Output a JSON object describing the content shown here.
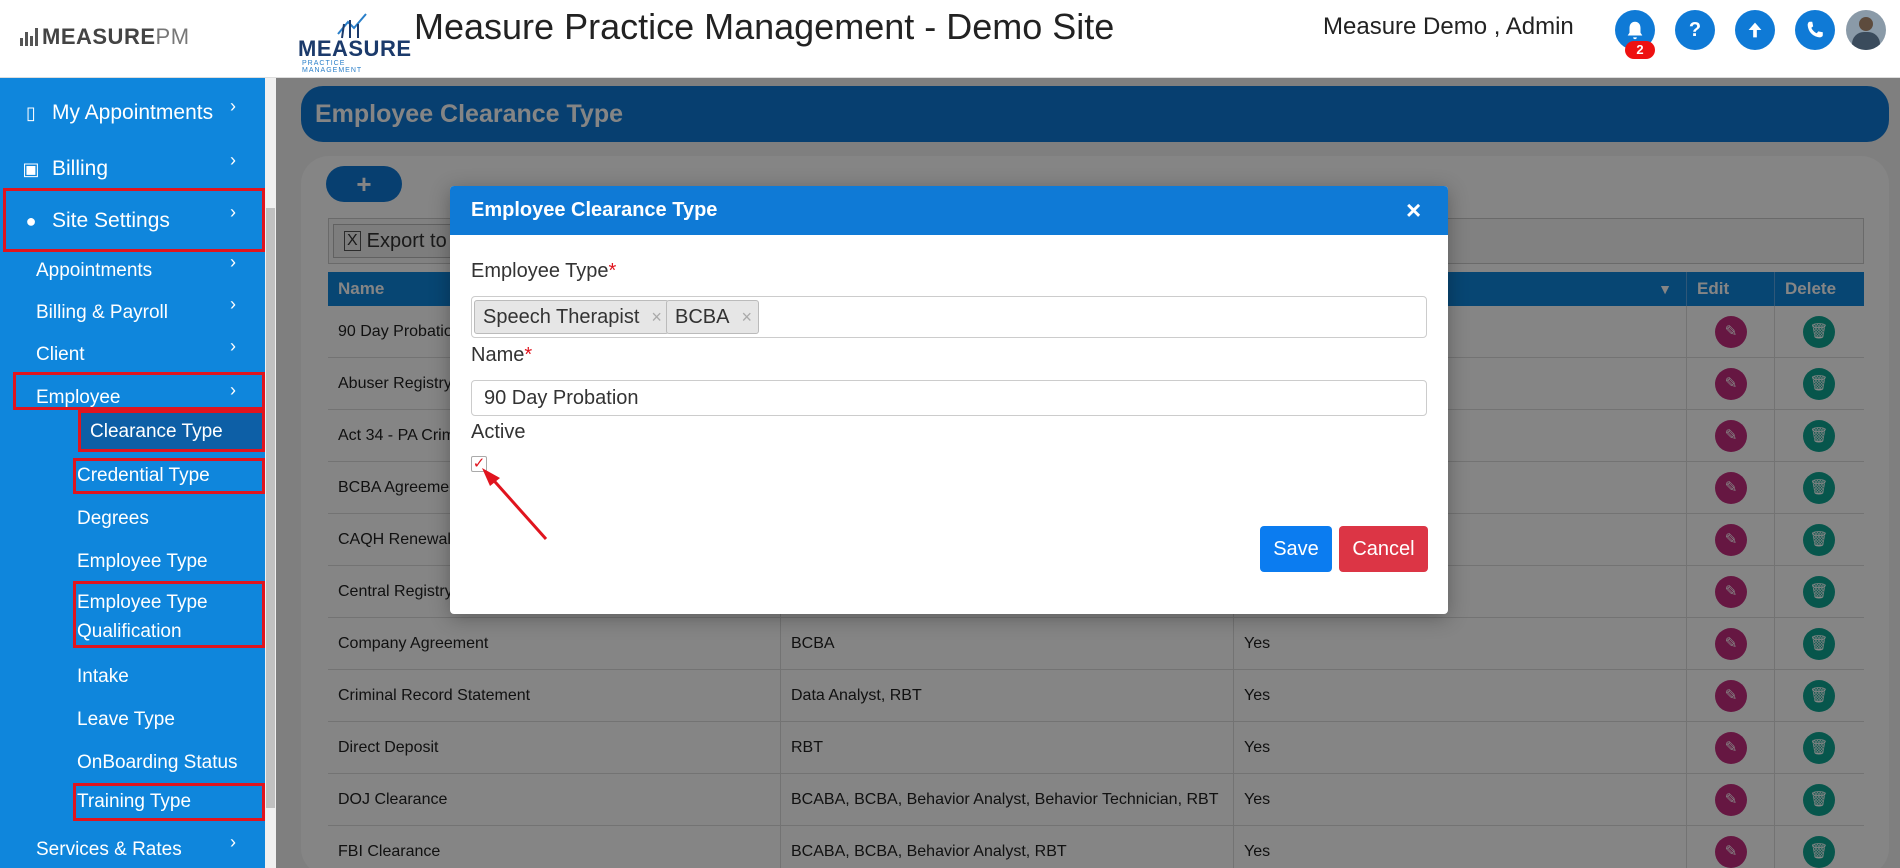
{
  "header": {
    "brand": "MEASURE",
    "brand_suffix": "PM",
    "logo_word": "MEASURE",
    "logo_subtitle": "PRACTICE MANAGEMENT",
    "title": "Measure Practice Management - Demo Site",
    "user": "Measure Demo , Admin",
    "notification_count": "2",
    "icons": [
      "bell-icon",
      "help-icon",
      "upload-icon",
      "phone-icon"
    ]
  },
  "sidebar": {
    "items": [
      {
        "label": "My Appointments",
        "icon": "building-icon"
      },
      {
        "label": "Billing",
        "icon": "money-icon"
      },
      {
        "label": "Site Settings",
        "icon": "user-icon"
      }
    ],
    "site_settings_children": [
      {
        "label": "Appointments"
      },
      {
        "label": "Billing & Payroll"
      },
      {
        "label": "Client"
      },
      {
        "label": "Employee"
      }
    ],
    "employee_children": [
      {
        "label": "Clearance Type"
      },
      {
        "label": "Credential Type"
      },
      {
        "label": "Degrees"
      },
      {
        "label": "Employee Type"
      },
      {
        "label": "Employee Type"
      },
      {
        "label": "Qualification"
      },
      {
        "label": "Intake"
      },
      {
        "label": "Leave Type"
      },
      {
        "label": "OnBoarding Status"
      },
      {
        "label": "Training Type"
      }
    ],
    "last_item": "Services & Rates"
  },
  "page": {
    "banner_title": "Employee Clearance Type",
    "add_button": "+",
    "export_label": "Export to E",
    "columns": [
      "Name",
      "",
      "",
      "Edit",
      "Delete"
    ],
    "rows": [
      {
        "name": "90 Day Probatio",
        "types": "",
        "active": ""
      },
      {
        "name": "Abuser Registry",
        "types": "",
        "active": ""
      },
      {
        "name": "Act 34 - PA Crim",
        "types": "",
        "active": ""
      },
      {
        "name": "BCBA Agreemen",
        "types": "",
        "active": ""
      },
      {
        "name": "CAQH Renewal",
        "types": "",
        "active": ""
      },
      {
        "name": "Central Registry",
        "types": "",
        "active": ""
      },
      {
        "name": "Company Agreement",
        "types": "BCBA",
        "active": "Yes"
      },
      {
        "name": "Criminal Record Statement",
        "types": "Data Analyst, RBT",
        "active": "Yes"
      },
      {
        "name": "Direct Deposit",
        "types": "RBT",
        "active": "Yes"
      },
      {
        "name": "DOJ Clearance",
        "types": "BCABA, BCBA, Behavior Analyst, Behavior Technician, RBT",
        "active": "Yes"
      },
      {
        "name": "FBI Clearance",
        "types": "BCABA, BCBA, Behavior Analyst, RBT",
        "active": "Yes"
      }
    ]
  },
  "modal": {
    "title": "Employee Clearance Type",
    "close": "×",
    "employee_type_label": "Employee Type",
    "employee_types": [
      "Speech Therapist",
      "BCBA"
    ],
    "name_label": "Name",
    "name_value": "90 Day Probation",
    "active_label": "Active",
    "active_checked": true,
    "save": "Save",
    "cancel": "Cancel",
    "required_mark": "*"
  },
  "colors": {
    "primary": "#0f7ad6",
    "sidebar": "#0f86dc",
    "highlight": "#e0141e",
    "edit": "#c42d7f",
    "delete": "#0fa593"
  }
}
